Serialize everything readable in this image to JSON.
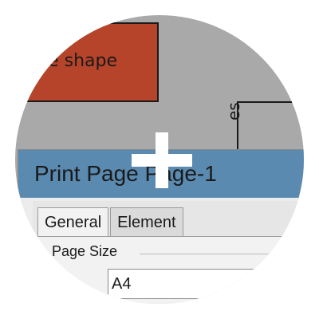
{
  "canvas": {
    "shape_label": "ble shape",
    "vertical_label": "es"
  },
  "dialog": {
    "title": "Print Page   Page-1",
    "tabs": [
      {
        "label": "General",
        "active": true
      },
      {
        "label": "Element",
        "active": false
      }
    ],
    "page_size_group": "Page Size",
    "page_size_value": "A4"
  },
  "colors": {
    "shape_fill": "#b5442a",
    "titlebar": "#5b8ab0",
    "background": "#a9a9a9"
  }
}
